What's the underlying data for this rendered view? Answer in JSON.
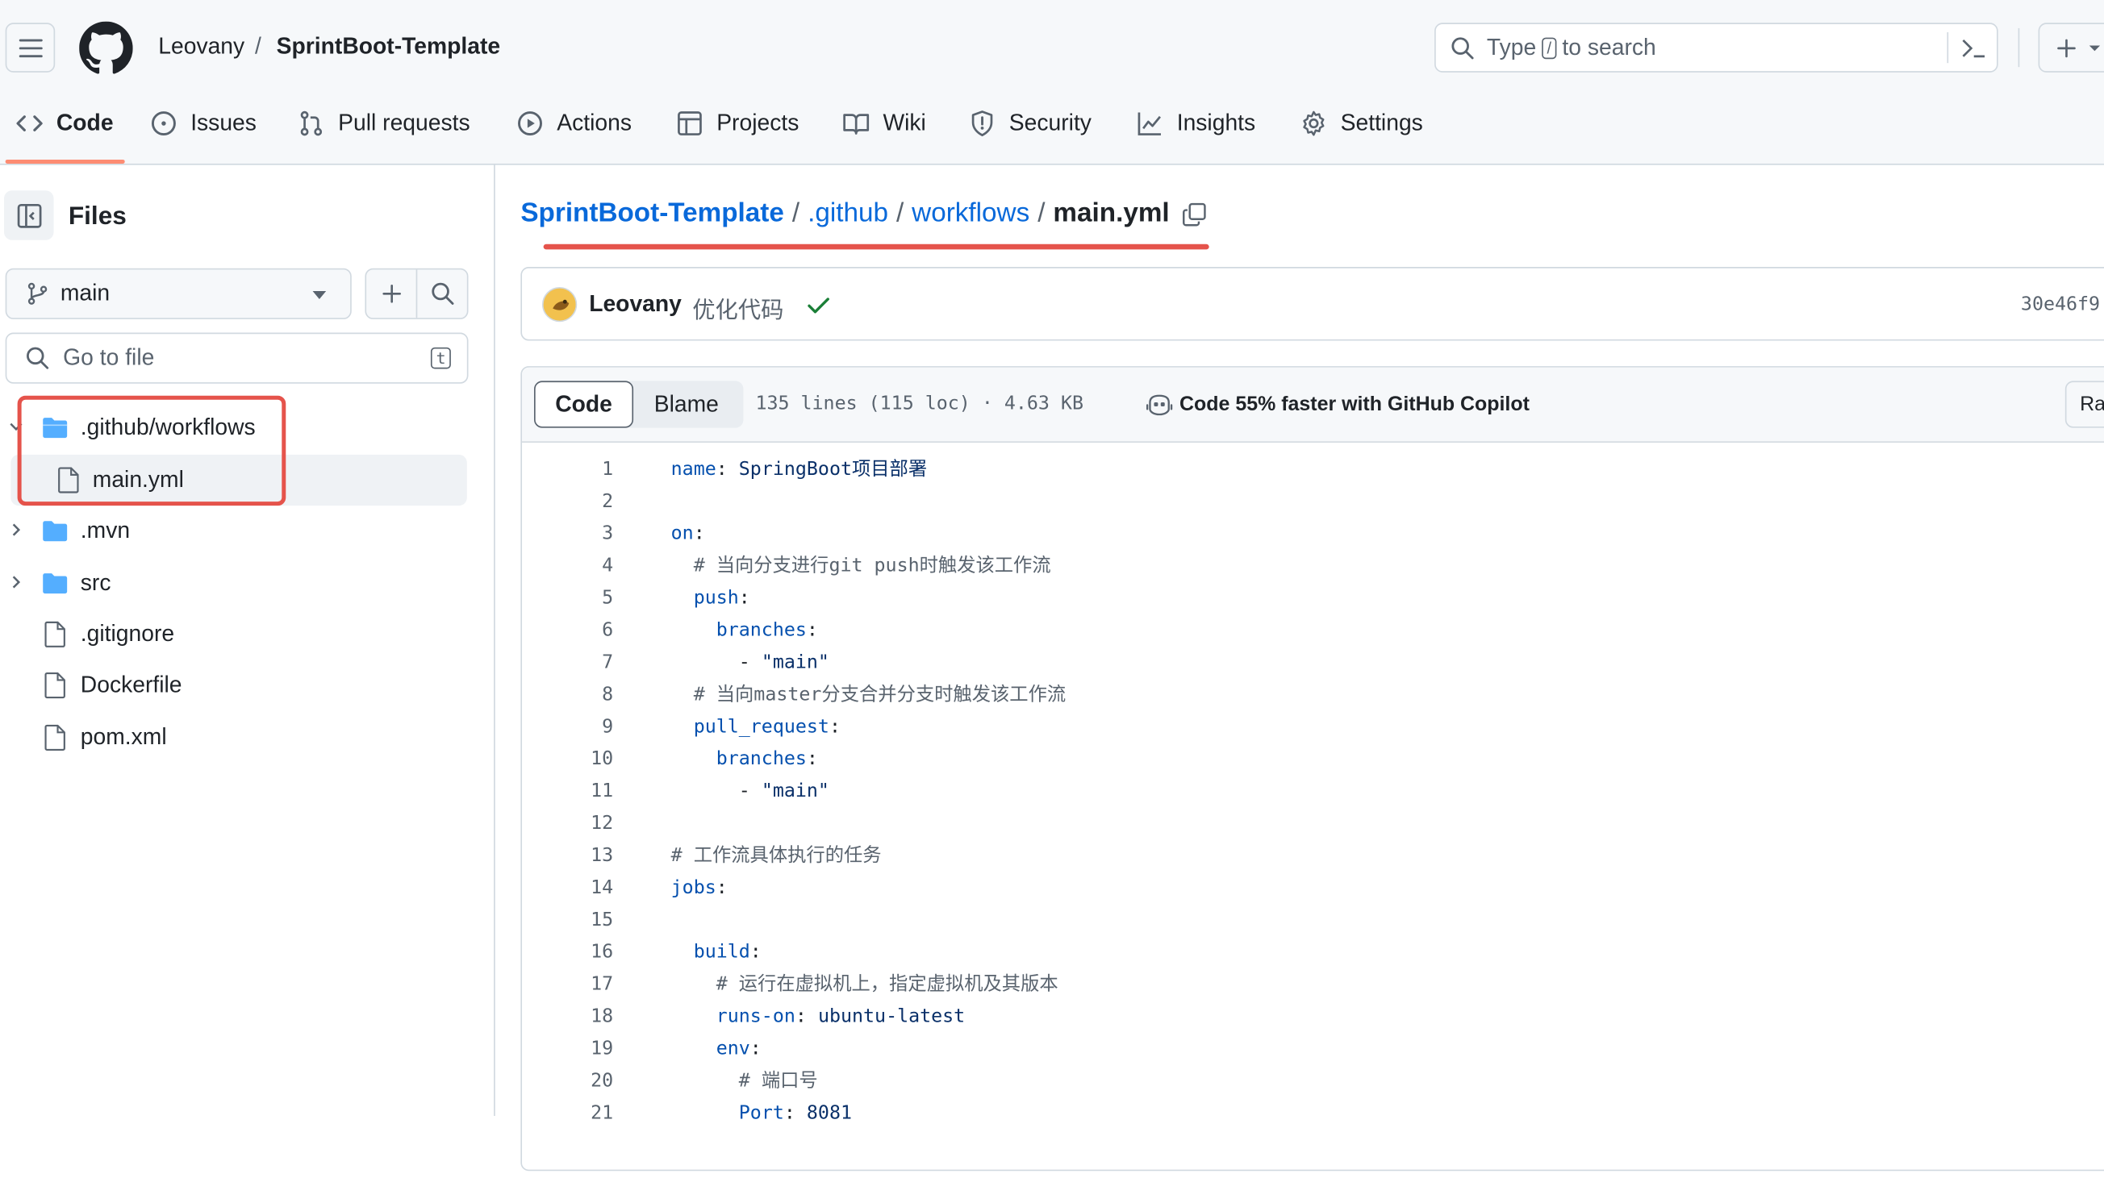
{
  "header": {
    "owner": "Leovany",
    "separator": "/",
    "repo": "SprintBoot-Template",
    "search_prefix": "Type",
    "search_key": "/",
    "search_suffix": "to search"
  },
  "nav": {
    "tabs": [
      {
        "label": "Code",
        "icon": "code-icon",
        "active": true
      },
      {
        "label": "Issues",
        "icon": "issue-icon"
      },
      {
        "label": "Pull requests",
        "icon": "pull-request-icon"
      },
      {
        "label": "Actions",
        "icon": "play-icon"
      },
      {
        "label": "Projects",
        "icon": "table-icon"
      },
      {
        "label": "Wiki",
        "icon": "book-icon"
      },
      {
        "label": "Security",
        "icon": "shield-icon"
      },
      {
        "label": "Insights",
        "icon": "graph-icon"
      },
      {
        "label": "Settings",
        "icon": "gear-icon"
      }
    ],
    "active_color": "#fd8c73"
  },
  "sidebar": {
    "title": "Files",
    "branch": "main",
    "goto_placeholder": "Go to file",
    "goto_key": "t",
    "tree": [
      {
        "label": ".github/workflows",
        "type": "folder",
        "expanded": true
      },
      {
        "label": "main.yml",
        "type": "file",
        "selected": true
      },
      {
        "label": ".mvn",
        "type": "folder"
      },
      {
        "label": "src",
        "type": "folder"
      },
      {
        "label": ".gitignore",
        "type": "file"
      },
      {
        "label": "Dockerfile",
        "type": "file"
      },
      {
        "label": "pom.xml",
        "type": "file"
      }
    ]
  },
  "breadcrumb": {
    "repo": "SprintBoot-Template",
    "dir1": ".github",
    "dir2": "workflows",
    "file": "main.yml",
    "sep": "/"
  },
  "commit": {
    "author": "Leovany",
    "message": "优化代码",
    "hash": "30e46f9"
  },
  "file": {
    "tab_code": "Code",
    "tab_blame": "Blame",
    "stats": "135 lines (115 loc) · 4.63 KB",
    "copilot": "Code 55% faster with GitHub Copilot",
    "raw": "Ra"
  },
  "code": [
    {
      "n": "1",
      "text": "name: SpringBoot项目部署"
    },
    {
      "n": "2",
      "text": ""
    },
    {
      "n": "3",
      "text": "on:"
    },
    {
      "n": "4",
      "text": "  # 当向分支进行git push时触发该工作流"
    },
    {
      "n": "5",
      "text": "  push:"
    },
    {
      "n": "6",
      "text": "    branches:"
    },
    {
      "n": "7",
      "text": "      - \"main\""
    },
    {
      "n": "8",
      "text": "  # 当向master分支合并分支时触发该工作流"
    },
    {
      "n": "9",
      "text": "  pull_request:"
    },
    {
      "n": "10",
      "text": "    branches:"
    },
    {
      "n": "11",
      "text": "      - \"main\""
    },
    {
      "n": "12",
      "text": ""
    },
    {
      "n": "13",
      "text": "# 工作流具体执行的任务"
    },
    {
      "n": "14",
      "text": "jobs:"
    },
    {
      "n": "15",
      "text": ""
    },
    {
      "n": "16",
      "text": "  build:"
    },
    {
      "n": "17",
      "text": "    # 运行在虚拟机上，指定虚拟机及其版本"
    },
    {
      "n": "18",
      "text": "    runs-on: ubuntu-latest"
    },
    {
      "n": "19",
      "text": "    env:"
    },
    {
      "n": "20",
      "text": "      # 端口号"
    },
    {
      "n": "21",
      "text": "      Port: 8081"
    }
  ],
  "colors": {
    "link": "#0969da",
    "annotation_red": "#e5534b",
    "success": "#1a7f37",
    "folder": "#54aeff"
  }
}
